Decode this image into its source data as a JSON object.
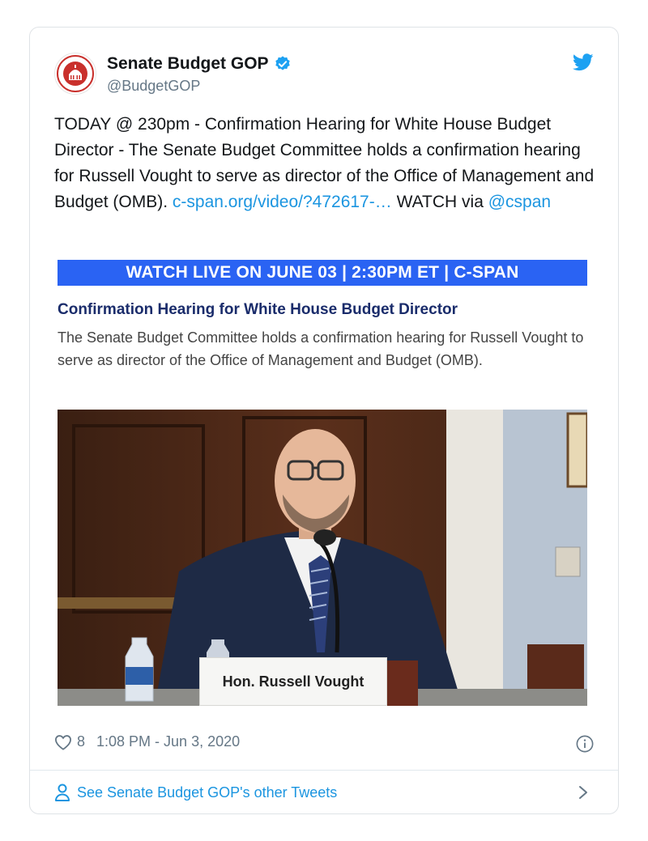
{
  "account": {
    "display_name": "Senate Budget GOP",
    "handle": "@BudgetGOP",
    "verified": true
  },
  "tweet": {
    "text_part1": "TODAY @ 230pm - Confirmation Hearing for White House Budget Director - The Senate Budget Committee holds a confirmation hearing for Russell Vought to serve as director of the Office of Management and Budget (OMB). ",
    "link": "c-span.org/video/?472617-…",
    "text_part2": " WATCH via ",
    "mention": "@cspan"
  },
  "media": {
    "banner": "WATCH LIVE ON JUNE 03 | 2:30PM ET | C-SPAN",
    "event_title": "Confirmation Hearing for White House Budget Director",
    "event_description": "The Senate Budget Committee holds a confirmation hearing for Russell Vought to serve as director of the Office of Management and Budget (OMB).",
    "nameplate": "Hon. Russell Vought"
  },
  "meta": {
    "likes": "8",
    "timestamp": "1:08 PM - Jun 3, 2020"
  },
  "footer": {
    "see_more": "See Senate Budget GOP's other Tweets"
  },
  "colors": {
    "link": "#1b95e0",
    "banner": "#2a63f3",
    "event_title": "#1a2c6b",
    "verified": "#1da1f2"
  },
  "icons": [
    "senate-seal-avatar",
    "verified-badge-icon",
    "twitter-bird-icon",
    "heart-icon",
    "info-icon",
    "person-icon",
    "chevron-right-icon"
  ]
}
